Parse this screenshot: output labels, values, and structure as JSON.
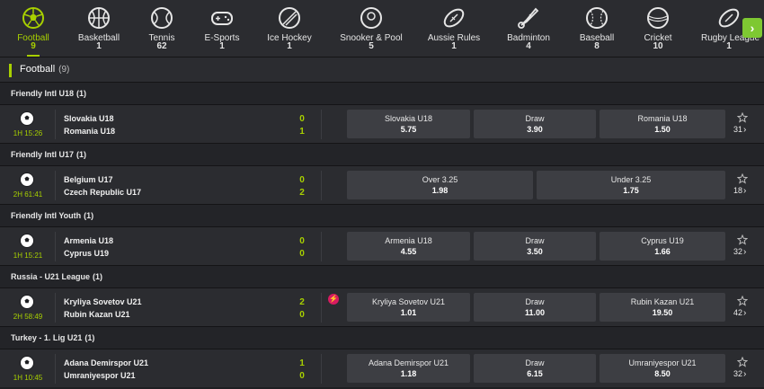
{
  "sports": [
    {
      "label": "Football",
      "count": "9",
      "icon": "football-icon",
      "active": true
    },
    {
      "label": "Basketball",
      "count": "1",
      "icon": "basketball-icon"
    },
    {
      "label": "Tennis",
      "count": "62",
      "icon": "tennis-icon"
    },
    {
      "label": "E-Sports",
      "count": "1",
      "icon": "gamepad-icon"
    },
    {
      "label": "Ice Hockey",
      "count": "1",
      "icon": "ice-hockey-puck-icon"
    },
    {
      "label": "Snooker & Pool",
      "count": "5",
      "icon": "snooker-ball-icon"
    },
    {
      "label": "Aussie Rules",
      "count": "1",
      "icon": "aussie-rules-ball-icon"
    },
    {
      "label": "Badminton",
      "count": "4",
      "icon": "shuttlecock-icon"
    },
    {
      "label": "Baseball",
      "count": "8",
      "icon": "baseball-icon"
    },
    {
      "label": "Cricket",
      "count": "10",
      "icon": "cricket-ball-icon"
    },
    {
      "label": "Rugby League",
      "count": "1",
      "icon": "rugby-ball-icon"
    }
  ],
  "section": {
    "title": "Football",
    "count": "(9)"
  },
  "colors": {
    "accent": "#a8d000",
    "next_button": "#7ec832",
    "flash_badge": "#d81b60"
  },
  "leagues": [
    {
      "name": "Friendly Intl U18",
      "count": "(1)",
      "match": {
        "clock": "1H 15:26",
        "home": "Slovakia U18",
        "away": "Romania U18",
        "home_score": "0",
        "away_score": "1",
        "odds": [
          {
            "label": "Slovakia U18",
            "value": "5.75"
          },
          {
            "label": "Draw",
            "value": "3.90"
          },
          {
            "label": "Romania U18",
            "value": "1.50"
          }
        ],
        "more": "31"
      }
    },
    {
      "name": "Friendly Intl U17",
      "count": "(1)",
      "match": {
        "clock": "2H 61:41",
        "home": "Belgium U17",
        "away": "Czech Republic U17",
        "home_score": "0",
        "away_score": "2",
        "odds": [
          {
            "label": "Over  3.25",
            "value": "1.98"
          },
          {
            "label": "Under  3.25",
            "value": "1.75"
          }
        ],
        "more": "18"
      }
    },
    {
      "name": "Friendly Intl Youth",
      "count": "(1)",
      "match": {
        "clock": "1H 15:21",
        "home": "Armenia U18",
        "away": "Cyprus U19",
        "home_score": "0",
        "away_score": "0",
        "odds": [
          {
            "label": "Armenia U18",
            "value": "4.55"
          },
          {
            "label": "Draw",
            "value": "3.50"
          },
          {
            "label": "Cyprus U19",
            "value": "1.66"
          }
        ],
        "more": "32"
      }
    },
    {
      "name": "Russia - U21 League",
      "count": "(1)",
      "match": {
        "clock": "2H 58:49",
        "home": "Kryliya Sovetov U21",
        "away": "Rubin Kazan U21",
        "home_score": "2",
        "away_score": "0",
        "flash": true,
        "odds": [
          {
            "label": "Kryliya Sovetov U21",
            "value": "1.01"
          },
          {
            "label": "Draw",
            "value": "11.00"
          },
          {
            "label": "Rubin Kazan U21",
            "value": "19.50"
          }
        ],
        "more": "42"
      }
    },
    {
      "name": "Turkey - 1. Lig U21",
      "count": "(1)",
      "match": {
        "clock": "1H 10:45",
        "home": "Adana Demirspor U21",
        "away": "Umraniyespor U21",
        "home_score": "1",
        "away_score": "0",
        "odds": [
          {
            "label": "Adana Demirspor U21",
            "value": "1.18"
          },
          {
            "label": "Draw",
            "value": "6.15"
          },
          {
            "label": "Umraniyespor U21",
            "value": "8.50"
          }
        ],
        "more": "32"
      }
    }
  ]
}
